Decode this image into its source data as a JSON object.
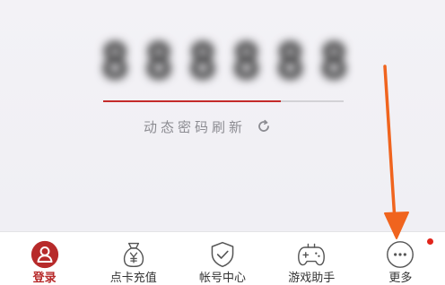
{
  "token": {
    "digits": [
      "8",
      "8",
      "8",
      "8",
      "8",
      "8"
    ],
    "progress": 0.74,
    "refresh_label": "动态密码刷新",
    "refresh_icon": "refresh-icon"
  },
  "nav": {
    "items": [
      {
        "label": "登录",
        "icon": "user-icon",
        "active": true
      },
      {
        "label": "点卡充值",
        "icon": "money-bag-icon",
        "active": false
      },
      {
        "label": "帐号中心",
        "icon": "shield-check-icon",
        "active": false
      },
      {
        "label": "游戏助手",
        "icon": "gamepad-icon",
        "active": false
      },
      {
        "label": "更多",
        "icon": "more-icon",
        "active": false,
        "badge": true
      }
    ]
  },
  "colors": {
    "accent": "#b72a2a",
    "progress": "#c42a2a",
    "annotation_arrow": "#f0641e",
    "badge": "#e1251b"
  }
}
